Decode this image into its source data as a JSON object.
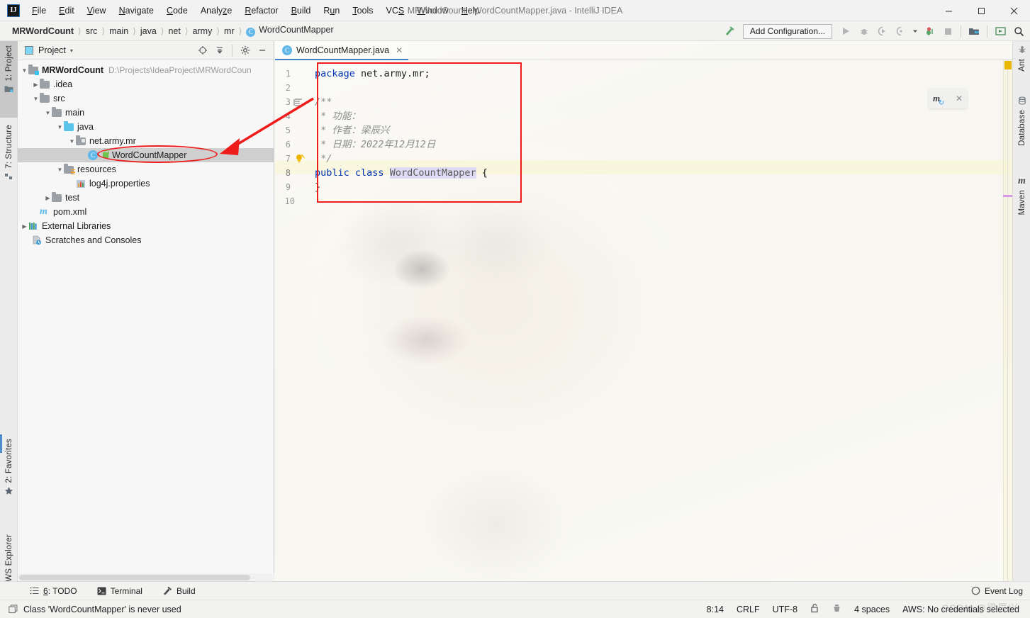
{
  "window": {
    "title": "MRWordCount - WordCountMapper.java - IntelliJ IDEA",
    "logo": "IJ",
    "minimize": "—",
    "maximize": "☐",
    "close": "✕"
  },
  "menu": {
    "items": [
      {
        "label": "File",
        "mnemonic": "F"
      },
      {
        "label": "Edit",
        "mnemonic": "E"
      },
      {
        "label": "View",
        "mnemonic": "V"
      },
      {
        "label": "Navigate",
        "mnemonic": "N"
      },
      {
        "label": "Code",
        "mnemonic": "C"
      },
      {
        "label": "Analyze",
        "mnemonic": "z"
      },
      {
        "label": "Refactor",
        "mnemonic": "R"
      },
      {
        "label": "Build",
        "mnemonic": "B"
      },
      {
        "label": "Run",
        "mnemonic": "u"
      },
      {
        "label": "Tools",
        "mnemonic": "T"
      },
      {
        "label": "VCS",
        "mnemonic": "S"
      },
      {
        "label": "Window",
        "mnemonic": "W"
      },
      {
        "label": "Help",
        "mnemonic": "H"
      }
    ]
  },
  "navbar": {
    "breadcrumbs": [
      {
        "label": "MRWordCount",
        "icon": null
      },
      {
        "label": "src",
        "icon": null
      },
      {
        "label": "main",
        "icon": null
      },
      {
        "label": "java",
        "icon": null
      },
      {
        "label": "net",
        "icon": null
      },
      {
        "label": "army",
        "icon": null
      },
      {
        "label": "mr",
        "icon": null
      },
      {
        "label": "WordCountMapper",
        "icon": "class-icon"
      }
    ],
    "separator": "〉",
    "build_label": "build-hammer-icon",
    "add_configuration": "Add Configuration...",
    "run_icon": "run-icon",
    "debug_icon": "debug-icon",
    "run_coverage_icon": "run-with-coverage-icon",
    "profiler_icon": "profiler-icon",
    "stop_icon": "stop-icon",
    "project_structure_icon": "project-structure-icon",
    "updates_icon": "updates-icon",
    "search_icon": "search-everywhere-icon"
  },
  "left_tool_tabs": [
    {
      "label": "1: Project",
      "icon": "project-icon",
      "active": true
    },
    {
      "label": "7: Structure",
      "icon": "structure-icon",
      "active": false
    },
    {
      "label": "2: Favorites",
      "icon": "star-icon",
      "active": false
    },
    {
      "label": "AWS Explorer",
      "icon": "aws-icon",
      "active": false
    }
  ],
  "right_tool_tabs": [
    {
      "label": "Ant",
      "icon": "ant-icon"
    },
    {
      "label": "Database",
      "icon": "database-icon"
    },
    {
      "label": "Maven",
      "icon": "maven-icon"
    }
  ],
  "project_panel": {
    "title": "Project",
    "caret": "▾",
    "actions": [
      {
        "name": "select-opened-file-icon",
        "glyph": "⊕"
      },
      {
        "name": "collapse-all-icon",
        "glyph": "≡"
      },
      {
        "name": "settings-gear-icon",
        "glyph": "⚙"
      },
      {
        "name": "hide-panel-icon",
        "glyph": "—"
      }
    ],
    "tree": [
      {
        "label": "MRWordCount",
        "sublabel": "D:\\Projects\\IdeaProject\\MRWordCoun",
        "indent": 0,
        "arrow": "▼",
        "icon": "module-folder-icon",
        "bold": true,
        "selected": false
      },
      {
        "label": ".idea",
        "sublabel": "",
        "indent": 1,
        "arrow": "▶",
        "icon": "folder-icon",
        "bold": false,
        "selected": false
      },
      {
        "label": "src",
        "sublabel": "",
        "indent": 1,
        "arrow": "▼",
        "icon": "folder-icon",
        "bold": false,
        "selected": false
      },
      {
        "label": "main",
        "sublabel": "",
        "indent": 2,
        "arrow": "▼",
        "icon": "folder-icon",
        "bold": false,
        "selected": false
      },
      {
        "label": "java",
        "sublabel": "",
        "indent": 3,
        "arrow": "▼",
        "icon": "source-folder-icon",
        "bold": false,
        "selected": false
      },
      {
        "label": "net.army.mr",
        "sublabel": "",
        "indent": 4,
        "arrow": "▼",
        "icon": "package-icon",
        "bold": false,
        "selected": false
      },
      {
        "label": "WordCountMapper",
        "sublabel": "",
        "indent": 5,
        "arrow": "",
        "icon": "java-class-icon",
        "bold": false,
        "selected": true
      },
      {
        "label": "resources",
        "sublabel": "",
        "indent": 3,
        "arrow": "▼",
        "icon": "resources-folder-icon",
        "bold": false,
        "selected": false
      },
      {
        "label": "log4j.properties",
        "sublabel": "",
        "indent": 4,
        "arrow": "",
        "icon": "properties-file-icon",
        "bold": false,
        "selected": false
      },
      {
        "label": "test",
        "sublabel": "",
        "indent": 2,
        "arrow": "▶",
        "icon": "folder-icon",
        "bold": false,
        "selected": false
      },
      {
        "label": "pom.xml",
        "sublabel": "",
        "indent": 1,
        "arrow": "",
        "icon": "maven-pom-icon",
        "bold": false,
        "selected": false
      },
      {
        "label": "External Libraries",
        "sublabel": "",
        "indent": 0,
        "arrow": "▶",
        "icon": "libraries-icon",
        "bold": false,
        "selected": false
      },
      {
        "label": "Scratches and Consoles",
        "sublabel": "",
        "indent": 0,
        "arrow": "",
        "icon": "scratches-icon",
        "bold": false,
        "selected": false
      }
    ]
  },
  "editor": {
    "tab": {
      "label": "WordCountMapper.java",
      "icon": "java-class-icon",
      "close": "✕"
    },
    "line_numbers": [
      "1",
      "2",
      "3",
      "4",
      "5",
      "6",
      "7",
      "8",
      "9",
      "10"
    ],
    "current_line": 8,
    "lines": [
      {
        "n": 1,
        "tokens": [
          {
            "t": "package",
            "c": "k"
          },
          {
            "t": " net.army.mr;",
            "c": "plain"
          }
        ]
      },
      {
        "n": 2,
        "tokens": []
      },
      {
        "n": 3,
        "tokens": [
          {
            "t": "/**",
            "c": "cmt"
          }
        ]
      },
      {
        "n": 4,
        "tokens": [
          {
            "t": " * 功能：",
            "c": "cmt"
          }
        ]
      },
      {
        "n": 5,
        "tokens": [
          {
            "t": " * 作者：梁辰兴",
            "c": "cmt"
          }
        ]
      },
      {
        "n": 6,
        "tokens": [
          {
            "t": " * 日期：2022年12月12日",
            "c": "cmt"
          }
        ]
      },
      {
        "n": 7,
        "tokens": [
          {
            "t": " */",
            "c": "cmt"
          }
        ]
      },
      {
        "n": 8,
        "tokens": [
          {
            "t": "public",
            "c": "k"
          },
          {
            "t": " ",
            "c": "plain"
          },
          {
            "t": "class",
            "c": "k"
          },
          {
            "t": " ",
            "c": "plain"
          },
          {
            "t": "WordCountMapper",
            "c": "hl"
          },
          {
            "t": " {",
            "c": "plain"
          }
        ]
      },
      {
        "n": 9,
        "tokens": [
          {
            "t": "}",
            "c": "plain"
          }
        ]
      },
      {
        "n": 10,
        "tokens": []
      }
    ],
    "gutter_icons": [
      {
        "line": 3,
        "name": "code-folding-region-icon"
      },
      {
        "line": 7,
        "name": "intention-bulb-icon"
      }
    ],
    "stripe": {
      "warning": "warning-marker",
      "occurrence": "occurrence-marker"
    }
  },
  "maven_popup": {
    "icon": "maven-reload-icon",
    "close": "✕"
  },
  "bottom_tool_tabs": [
    {
      "label": "6: TODO",
      "mnemonic": "6",
      "icon": "todo-icon"
    },
    {
      "label": "Terminal",
      "mnemonic": "",
      "icon": "terminal-icon"
    },
    {
      "label": "Build",
      "mnemonic": "",
      "icon": "build-hammer-icon"
    }
  ],
  "event_log": {
    "label": "Event Log",
    "icon": "event-log-icon"
  },
  "statusbar": {
    "message": "Class 'WordCountMapper' is never used",
    "message_icon": "inspection-icon",
    "caret_position": "8:14",
    "line_separator": "CRLF",
    "encoding": "UTF-8",
    "readonly_icon": "lock-open-icon",
    "inspections_icon": "inspections-widget-icon",
    "indent": "4 spaces",
    "aws": "AWS: No credentials selected"
  },
  "watermark": "CSDN @梁辰兴",
  "colors": {
    "accent_blue": "#4083c9",
    "keyword_blue": "#0033b3",
    "comment_gray": "#8c8c8c",
    "annotation_red": "#ef1c1c",
    "selection_gray": "#cfcfcf",
    "class_icon_blue": "#62b8e8"
  }
}
